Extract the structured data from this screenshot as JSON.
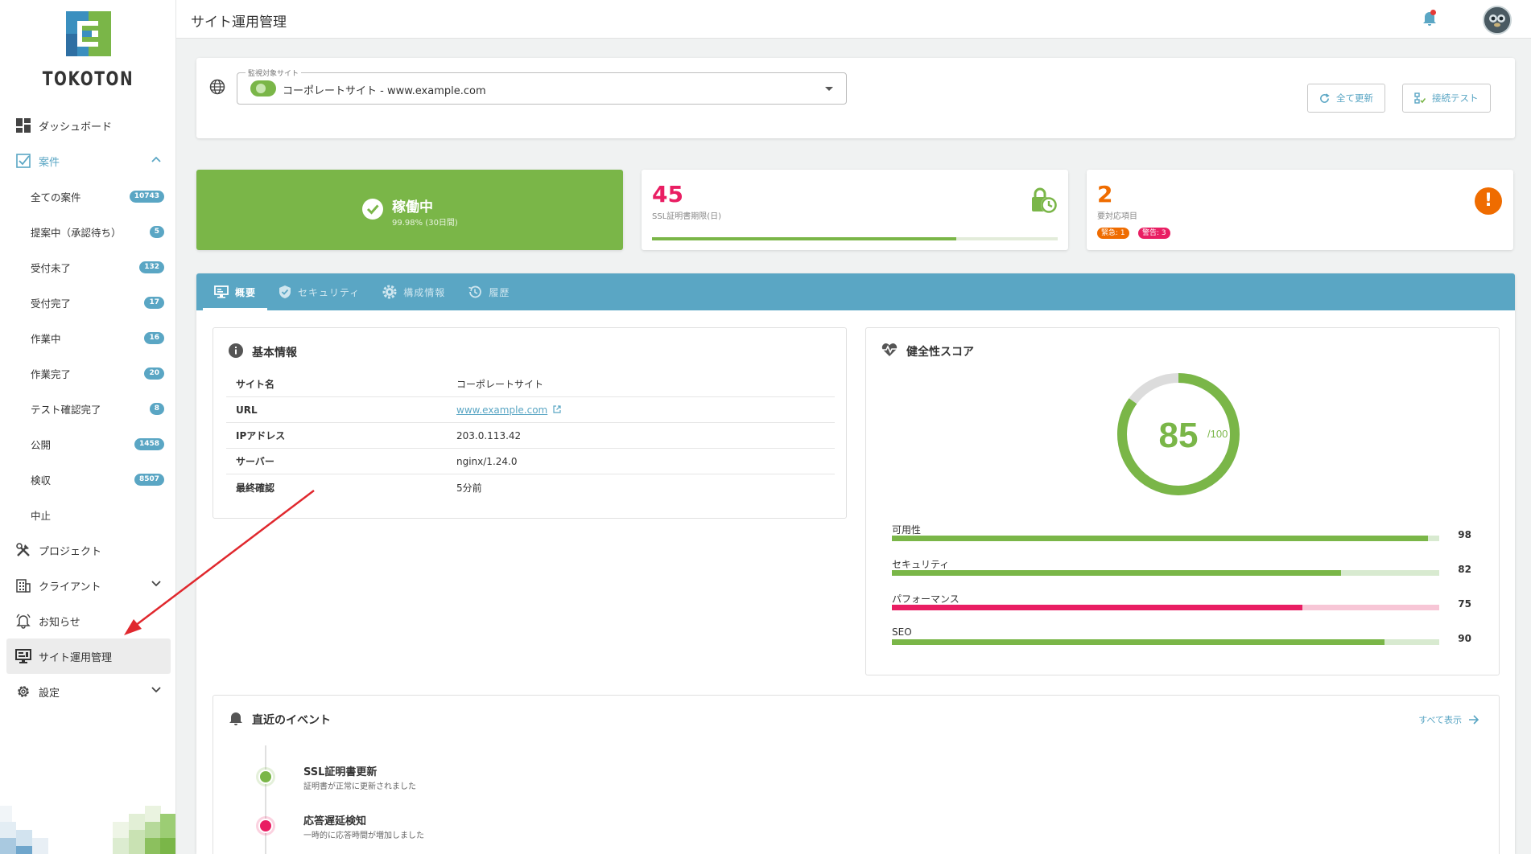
{
  "brand": {
    "name": "TOKOTON"
  },
  "sidebar": {
    "items": [
      {
        "label": "ダッシュボード"
      },
      {
        "label": "案件"
      },
      {
        "label": "プロジェクト"
      },
      {
        "label": "クライアント"
      },
      {
        "label": "お知らせ"
      },
      {
        "label": "サイト運用管理"
      },
      {
        "label": "設定"
      }
    ],
    "sub_items": [
      {
        "label": "全ての案件",
        "count": "10743"
      },
      {
        "label": "提案中（承認待ち）",
        "count": "5"
      },
      {
        "label": "受付未了",
        "count": "132"
      },
      {
        "label": "受付完了",
        "count": "17"
      },
      {
        "label": "作業中",
        "count": "16"
      },
      {
        "label": "作業完了",
        "count": "20"
      },
      {
        "label": "テスト確認完了",
        "count": "8"
      },
      {
        "label": "公開",
        "count": "1458"
      },
      {
        "label": "検収",
        "count": "8507"
      },
      {
        "label": "中止",
        "count": ""
      }
    ]
  },
  "header": {
    "title": "サイト運用管理"
  },
  "site_selector": {
    "legend": "監視対象サイト",
    "value": "コーポレートサイト - www.example.com",
    "refresh_all_label": "全て更新",
    "connection_test_label": "接続テスト"
  },
  "stats": {
    "status": {
      "title": "稼働中",
      "subtitle": "99.98% (30日間)"
    },
    "ssl": {
      "value": "45",
      "label": "SSL証明書期限(日)",
      "progress": 0.75
    },
    "alerts": {
      "value": "2",
      "label": "要対応項目",
      "urgent": "緊急: 1",
      "warning": "警告: 3"
    }
  },
  "tabs": [
    {
      "label": "概要"
    },
    {
      "label": "セキュリティ"
    },
    {
      "label": "構成情報"
    },
    {
      "label": "履歴"
    }
  ],
  "basic_info": {
    "title": "基本情報",
    "rows": [
      {
        "key": "サイト名",
        "value": "コーポレートサイト"
      },
      {
        "key": "URL",
        "value": "www.example.com"
      },
      {
        "key": "IPアドレス",
        "value": "203.0.113.42"
      },
      {
        "key": "サーバー",
        "value": "nginx/1.24.0"
      },
      {
        "key": "最終確認",
        "value": "5分前"
      }
    ]
  },
  "health": {
    "title": "健全性スコア",
    "score": "85",
    "max": "/100",
    "score_value": 85,
    "metrics": [
      {
        "label": "可用性",
        "value": "98",
        "pct": 98,
        "color": "#7ab648",
        "track": "#d8ead0"
      },
      {
        "label": "セキュリティ",
        "value": "82",
        "pct": 82,
        "color": "#7ab648",
        "track": "#d8ead0"
      },
      {
        "label": "パフォーマンス",
        "value": "75",
        "pct": 75,
        "color": "#e91e63",
        "track": "#f7c6d6"
      },
      {
        "label": "SEO",
        "value": "90",
        "pct": 90,
        "color": "#7ab648",
        "track": "#d8ead0"
      }
    ]
  },
  "events": {
    "title": "直近のイベント",
    "see_all": "すべて表示",
    "items": [
      {
        "title": "SSL証明書更新",
        "desc": "証明書が正常に更新されました",
        "color": "#7ab648"
      },
      {
        "title": "応答遅延検知",
        "desc": "一時的に応答時間が増加しました",
        "color": "#e91e63"
      }
    ]
  },
  "colors": {
    "accent": "#5aa6c4",
    "success": "#7ab648",
    "danger": "#e91e63",
    "warning": "#ef6c00"
  }
}
